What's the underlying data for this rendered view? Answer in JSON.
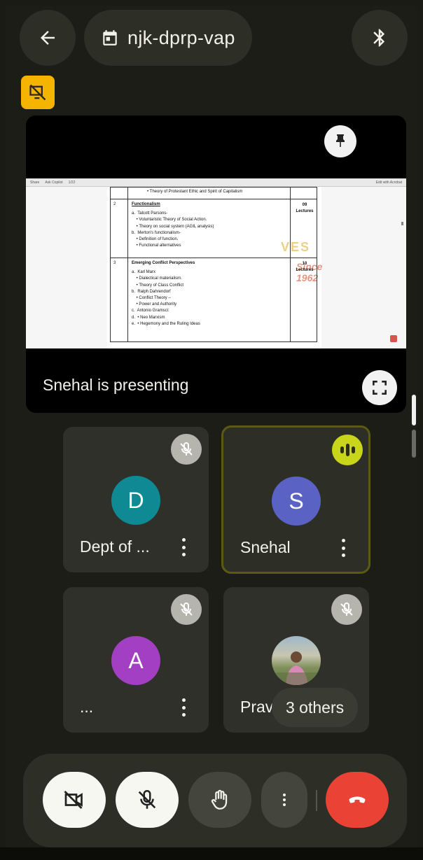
{
  "header": {
    "meeting_code": "njk-dprp-vap",
    "back_icon": "arrow-back-icon",
    "calendar_icon": "calendar-icon",
    "bluetooth_icon": "bluetooth-icon"
  },
  "badge": {
    "icon": "no-screen-share-icon",
    "color": "#f4b400"
  },
  "presentation": {
    "label": "Snehal is presenting",
    "pin_icon": "pin-icon",
    "fullscreen_icon": "fullscreen-icon",
    "document": {
      "toolbar_left": "Share",
      "toolbar_ask": "Ask Copilot",
      "toolbar_page": "1/22",
      "toolbar_right": "Edit with Acrobat",
      "watermark_text1": "VES",
      "watermark_text2": "Since 1962",
      "top_line": "• Theory of Protestant Ethic and Spirit of Capitalism",
      "rows": [
        {
          "num": "2",
          "heading": "Functionalism",
          "lines": [
            "a.  Talcott Parsons-",
            "    • Voluntaristic Theory of Social Action.",
            "    • Theory on social system (AGIL analysis)",
            "b.  Merton's functionalism-",
            "    • Definition of function.",
            "    • Functional alternatives"
          ],
          "lectures_num": "09",
          "lectures_label": "Lectures"
        },
        {
          "num": "3",
          "heading": "Emerging Conflict Perspectives",
          "lines": [
            "a.  Karl Marx",
            "    • Dialectical materialism.",
            "    • Theory of Class Conflict",
            "b.  Ralph Dahrendorf",
            "    • Conflict Theory –",
            "    • Power and Authority",
            "c.  Antonio Gramsci:",
            "d.  • Neo Marxism",
            "e.  • Hegemony and the Ruling Ideas"
          ],
          "lectures_num": "10",
          "lectures_label": "Lectures"
        }
      ]
    }
  },
  "participants": [
    {
      "name": "Dept of ...",
      "initial": "D",
      "avatar_color": "#0f8a94",
      "muted": true,
      "speaking": false
    },
    {
      "name": "Snehal",
      "initial": "S",
      "avatar_color": "#5a63c4",
      "muted": false,
      "speaking": true
    },
    {
      "name": "...",
      "initial": "A",
      "avatar_color": "#a23fc2",
      "muted": true,
      "speaking": false
    },
    {
      "name": "Pravin",
      "initial": "",
      "avatar_color": "",
      "muted": true,
      "speaking": false,
      "photo": true
    }
  ],
  "others_chip": "3 others",
  "controls": {
    "camera": "camera-off-icon",
    "mic": "mic-off-icon",
    "hand": "raise-hand-icon",
    "more": "more-vert-icon",
    "end": "end-call-icon",
    "end_color": "#ea4335"
  }
}
